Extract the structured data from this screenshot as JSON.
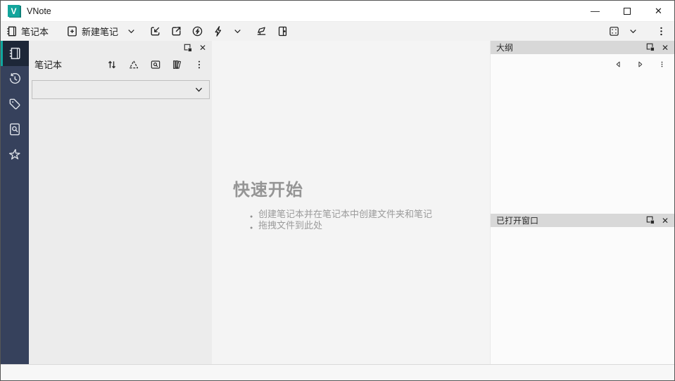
{
  "window": {
    "title": "VNote"
  },
  "titlebar": {
    "logo_letter": "V",
    "title": "VNote"
  },
  "icons": {
    "minimize": "—",
    "close": "✕"
  },
  "toolbar": {
    "notebook_label": "笔记本",
    "new_note_label": "新建笔记"
  },
  "activity_bar": {
    "items": [
      {
        "name": "notebooks",
        "active": true
      },
      {
        "name": "history",
        "active": false
      },
      {
        "name": "tags",
        "active": false
      },
      {
        "name": "full-text-search",
        "active": false
      },
      {
        "name": "snippets",
        "active": false
      }
    ]
  },
  "notebook_panel": {
    "title": "笔记本",
    "combobox_value": ""
  },
  "main": {
    "heading": "快速开始",
    "bullets": [
      "创建笔记本并在笔记本中创建文件夹和笔记",
      "拖拽文件到此处"
    ]
  },
  "outline_panel": {
    "title": "大纲"
  },
  "windows_panel": {
    "title": "已打开窗口"
  },
  "colors": {
    "accent_teal": "#12a59c",
    "activity_bar_bg": "#36415c",
    "activity_active_bg": "#1d2738",
    "panel_header_bg": "#d8d8d8"
  }
}
